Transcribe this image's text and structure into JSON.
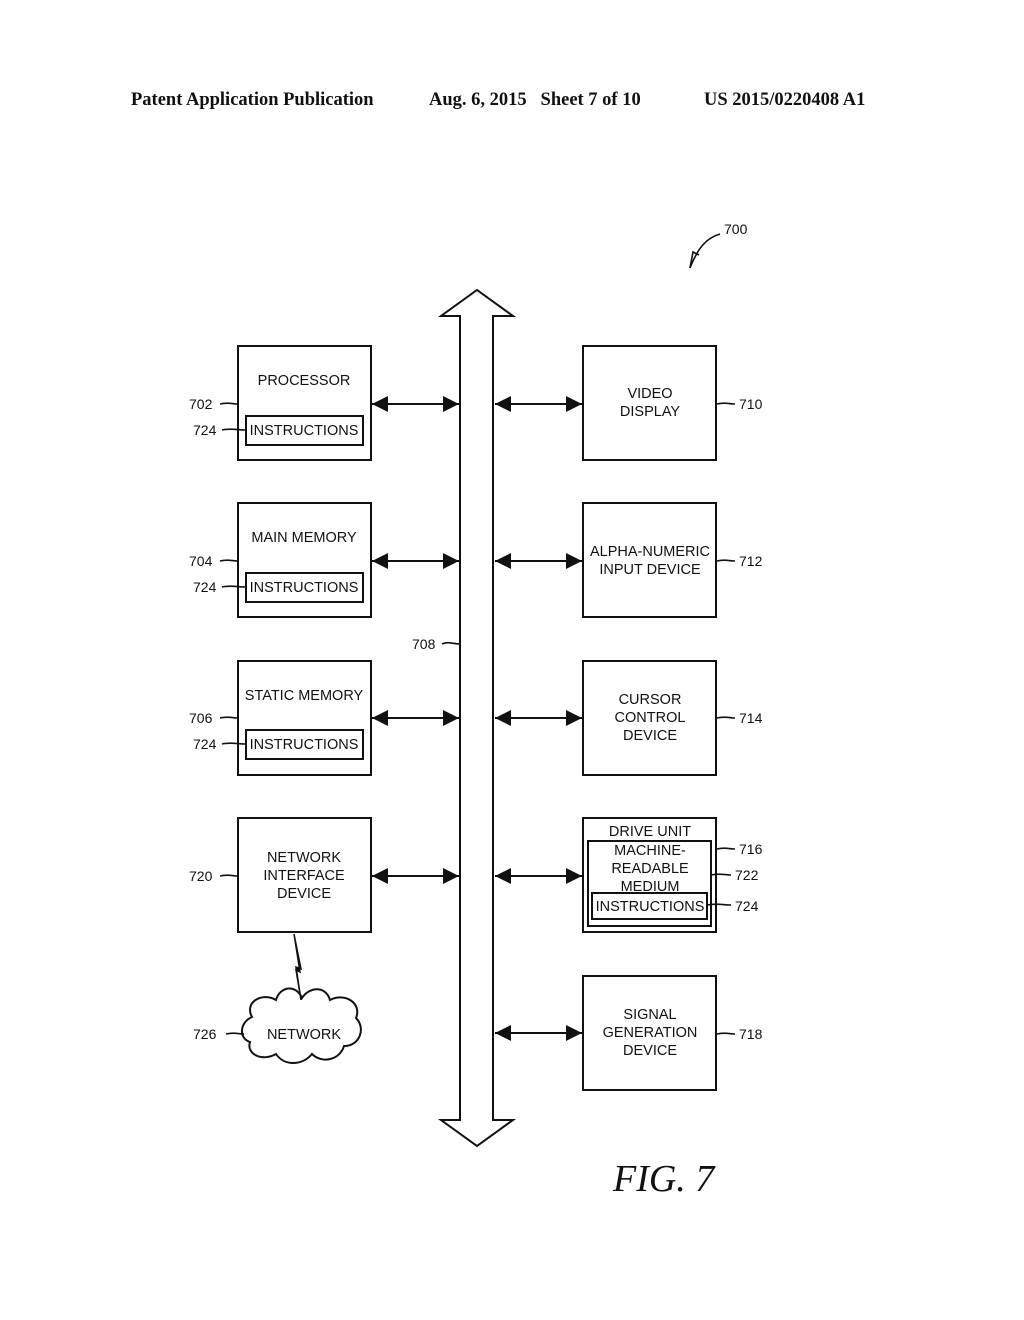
{
  "header": {
    "publication": "Patent Application Publication",
    "date_sheet": "Aug. 6, 2015   Sheet 7 of 10",
    "number": "US 2015/0220408 A1"
  },
  "figure": {
    "caption": "FIG. 7",
    "ref": "700",
    "bus_ref": "708"
  },
  "left_blocks": [
    {
      "ref": "702",
      "lines": [
        "PROCESSOR"
      ],
      "inner_label": "INSTRUCTIONS",
      "inner_ref": "724"
    },
    {
      "ref": "704",
      "lines": [
        "MAIN MEMORY"
      ],
      "inner_label": "INSTRUCTIONS",
      "inner_ref": "724"
    },
    {
      "ref": "706",
      "lines": [
        "STATIC MEMORY"
      ],
      "inner_label": "INSTRUCTIONS",
      "inner_ref": "724"
    },
    {
      "ref": "720",
      "lines": [
        "NETWORK",
        "INTERFACE",
        "DEVICE"
      ]
    }
  ],
  "right_blocks": [
    {
      "ref": "710",
      "lines": [
        "VIDEO",
        "DISPLAY"
      ]
    },
    {
      "ref": "712",
      "lines": [
        "ALPHA-NUMERIC",
        "INPUT DEVICE"
      ]
    },
    {
      "ref": "714",
      "lines": [
        "CURSOR",
        "CONTROL",
        "DEVICE"
      ]
    },
    {
      "ref": "716",
      "lines": [
        "DRIVE UNIT"
      ],
      "medium_lines": [
        "MACHINE-",
        "READABLE",
        "MEDIUM"
      ],
      "medium_ref": "722",
      "inner_label": "INSTRUCTIONS",
      "inner_ref": "724"
    },
    {
      "ref": "718",
      "lines": [
        "SIGNAL",
        "GENERATION",
        "DEVICE"
      ]
    }
  ],
  "network": {
    "label": "NETWORK",
    "ref": "726"
  }
}
